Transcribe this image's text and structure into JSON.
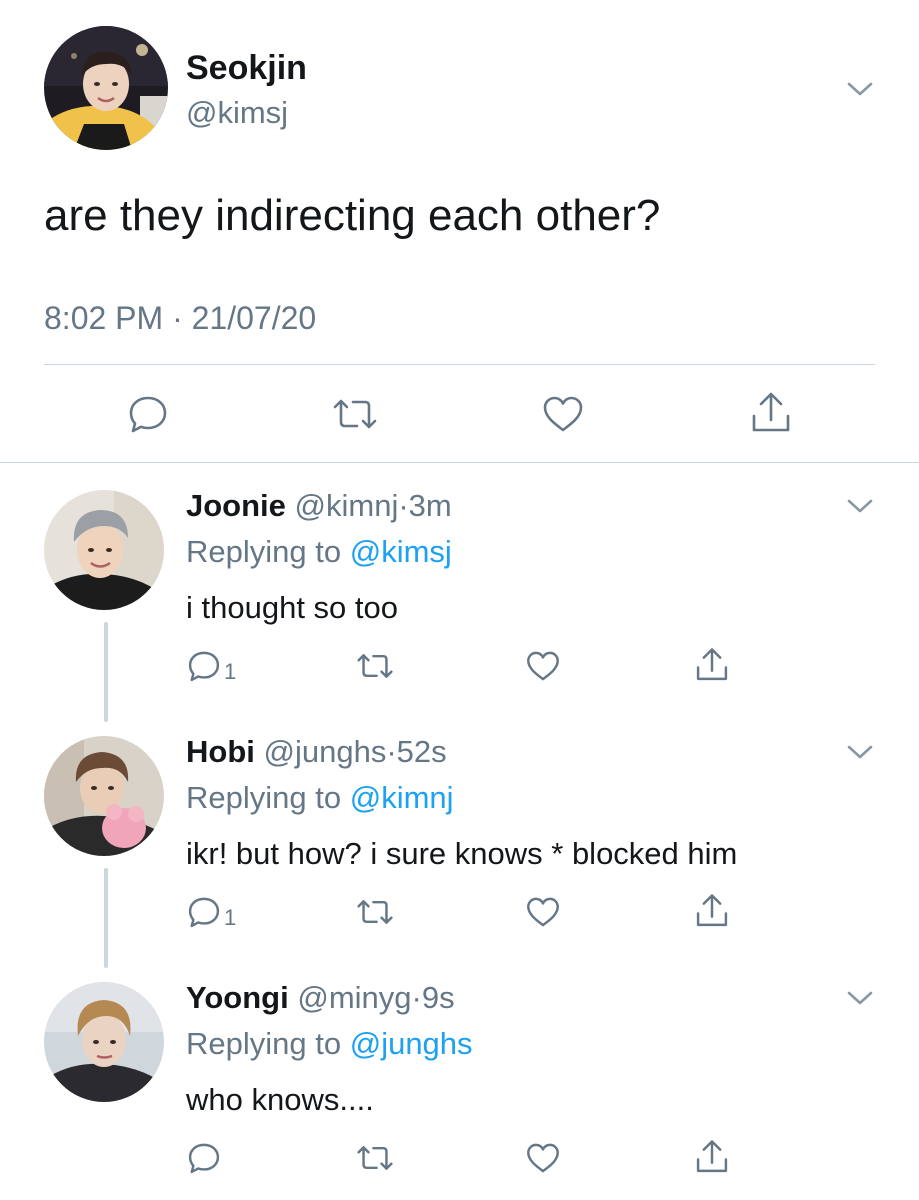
{
  "colors": {
    "text": "#14171a",
    "secondary": "#657786",
    "link": "#1da1f2",
    "divider": "#ccd6dd"
  },
  "main_tweet": {
    "name": "Seokjin",
    "handle": "@kimsj",
    "text": "are they indirecting each other?",
    "time": "8:02 PM · 21/07/20",
    "actions": [
      "reply-icon",
      "retweet-icon",
      "like-icon",
      "share-icon"
    ]
  },
  "replies": [
    {
      "name": "Joonie",
      "handle": "@kimnj",
      "sep": "·",
      "age": "3m",
      "replying_prefix": "Replying to ",
      "replying_to": "@kimsj",
      "text": "i thought so too",
      "reply_count": "1"
    },
    {
      "name": "Hobi",
      "handle": "@junghs",
      "sep": "·",
      "age": "52s",
      "replying_prefix": "Replying to ",
      "replying_to": "@kimnj",
      "text": "ikr! but how? i sure knows * blocked him",
      "reply_count": "1"
    },
    {
      "name": "Yoongi",
      "handle": "@minyg",
      "sep": "·",
      "age": "9s",
      "replying_prefix": "Replying to ",
      "replying_to": "@junghs",
      "text": "who knows....",
      "reply_count": ""
    }
  ]
}
